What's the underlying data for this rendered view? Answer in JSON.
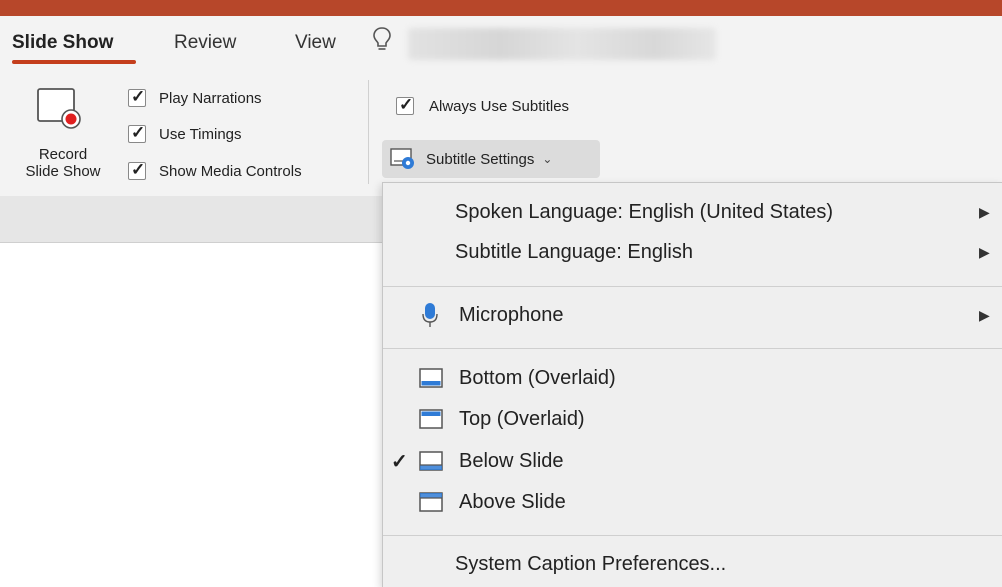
{
  "tabs": {
    "slide_show": "Slide Show",
    "review": "Review",
    "view": "View"
  },
  "icons": {
    "lightbulb": "lightbulb-icon",
    "record": "record-slide-show-icon",
    "subtitle": "subtitle-settings-icon",
    "microphone": "microphone-icon"
  },
  "colors": {
    "accent": "#b7472a",
    "tab_underline": "#c43e1c",
    "record_dot": "#e02020",
    "position_icon_blue": "#2f7bd6"
  },
  "record": {
    "line1": "Record",
    "line2": "Slide Show"
  },
  "checkboxes": {
    "play_narrations": {
      "label": "Play Narrations",
      "checked": true
    },
    "use_timings": {
      "label": "Use Timings",
      "checked": true
    },
    "show_media_controls": {
      "label": "Show Media Controls",
      "checked": true
    },
    "always_use_subtitles": {
      "label": "Always Use Subtitles",
      "checked": true
    }
  },
  "subtitle_settings": {
    "label": "Subtitle Settings",
    "chevron": "⌄"
  },
  "menu": {
    "spoken_language": "Spoken Language: English (United States)",
    "subtitle_language": "Subtitle Language: English",
    "microphone": "Microphone",
    "submenu_arrow": "▶",
    "bottom_overlaid": "Bottom (Overlaid)",
    "top_overlaid": "Top (Overlaid)",
    "below_slide": "Below Slide",
    "above_slide": "Above Slide",
    "checkmark": "✓",
    "selected_position": "Below Slide",
    "system_caption": "System Caption Preferences..."
  }
}
